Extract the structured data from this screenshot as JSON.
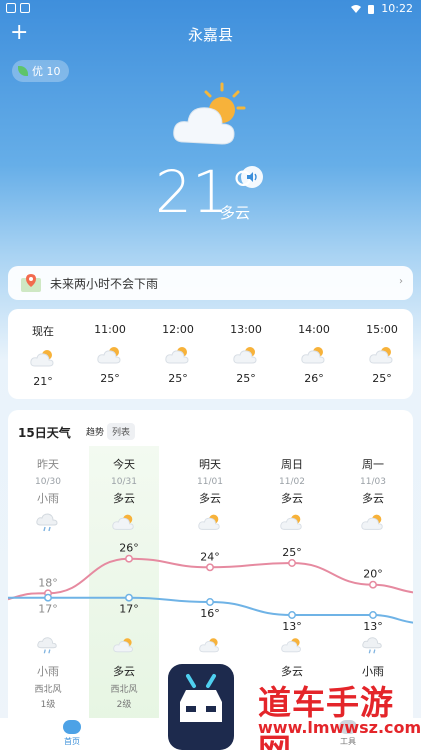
{
  "status_bar": {
    "time": "10:22"
  },
  "header": {
    "city": "永嘉县",
    "add_label": "+"
  },
  "aqi": {
    "label": "优 10"
  },
  "current": {
    "temp": "21°",
    "condition": "多云"
  },
  "rain_banner": {
    "text": "未来两小时不会下雨"
  },
  "hourly": [
    {
      "time": "现在",
      "temp": "21°",
      "icon": "partly-cloudy-icon"
    },
    {
      "time": "11:00",
      "temp": "25°",
      "icon": "partly-cloudy-icon"
    },
    {
      "time": "12:00",
      "temp": "25°",
      "icon": "partly-cloudy-icon"
    },
    {
      "time": "13:00",
      "temp": "25°",
      "icon": "partly-cloudy-icon"
    },
    {
      "time": "14:00",
      "temp": "26°",
      "icon": "partly-cloudy-icon"
    },
    {
      "time": "15:00",
      "temp": "25°",
      "icon": "partly-cloudy-icon"
    }
  ],
  "daily": {
    "title": "15日天气",
    "tabs": {
      "trend": "趋势",
      "list": "列表"
    },
    "days": [
      {
        "name": "昨天",
        "date": "10/30",
        "cond_day": "小雨",
        "high": "18°",
        "low": "17°",
        "cond_night": "小雨",
        "wind": "西北风",
        "level": "1级"
      },
      {
        "name": "今天",
        "date": "10/31",
        "cond_day": "多云",
        "high": "26°",
        "low": "17°",
        "cond_night": "多云",
        "wind": "西北风",
        "level": "2级"
      },
      {
        "name": "明天",
        "date": "11/01",
        "cond_day": "多云",
        "high": "24°",
        "low": "16°",
        "cond_night": "",
        "wind": "",
        "level": ""
      },
      {
        "name": "周日",
        "date": "11/02",
        "cond_day": "多云",
        "high": "25°",
        "low": "13°",
        "cond_night": "多云",
        "wind": "",
        "level": ""
      },
      {
        "name": "周一",
        "date": "11/03",
        "cond_day": "多云",
        "high": "20°",
        "low": "13°",
        "cond_night": "小雨",
        "wind": "",
        "level": ""
      }
    ]
  },
  "chart_data": {
    "type": "line",
    "categories": [
      "昨天",
      "今天",
      "明天",
      "周日",
      "周一"
    ],
    "series": [
      {
        "values": [
          18,
          26,
          24,
          25,
          20
        ]
      },
      {
        "values": [
          17,
          17,
          16,
          13,
          13
        ]
      }
    ],
    "colors": {
      "high": "#e68aa0",
      "low": "#6fb3e6"
    }
  },
  "bottom_nav": {
    "home": "首页",
    "tools": "工具"
  },
  "watermark": {
    "text": "道车手游网",
    "url": "www.lmwwsz.com"
  }
}
